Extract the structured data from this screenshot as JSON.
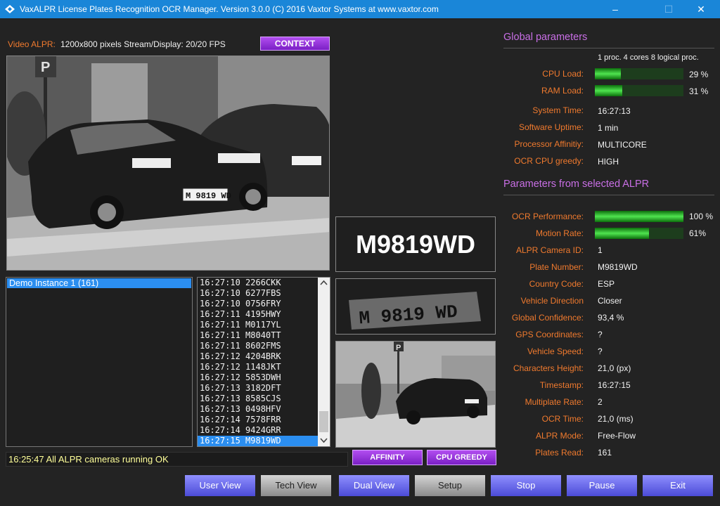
{
  "window": {
    "title": "VaxALPR License Plates Recognition OCR Manager. Version 3.0.0 (C) 2016 Vaxtor Systems at www.vaxtor.com",
    "minimize": "–",
    "maximize": "☐",
    "close": "✕"
  },
  "video": {
    "label": "Video ALPR:",
    "info": "1200x800 pixels Stream/Display: 20/20 FPS",
    "context_button": "CONTEXT",
    "plate_in_image": "M 9819 WD"
  },
  "recognized_plate": "M9819WD",
  "plate_crop_text": "M 9819 WD",
  "instances": [
    {
      "label": "Demo Instance 1 (161)"
    }
  ],
  "plate_reads": [
    "16:27:10 2266CKK",
    "16:27:10 6277FBS",
    "16:27:10 0756FRY",
    "16:27:11 4195HWY",
    "16:27:11 M0117YL",
    "16:27:11 M8040TT",
    "16:27:11 8602FMS",
    "16:27:12 4204BRK",
    "16:27:12 1148JKT",
    "16:27:12 5853DWH",
    "16:27:13 3182DFT",
    "16:27:13 8585CJS",
    "16:27:13 0498HFV",
    "16:27:14 7578FRR",
    "16:27:14 9424GRR",
    "16:27:15 M9819WD"
  ],
  "status_message": "16:25:47 All ALPR cameras running OK",
  "mid_buttons": {
    "affinity": "AFFINITY",
    "cpu_greedy": "CPU GREEDY"
  },
  "bottom_buttons": {
    "user_view": "User View",
    "tech_view": "Tech View",
    "dual_view": "Dual View",
    "setup": "Setup",
    "stop": "Stop",
    "pause": "Pause",
    "exit": "Exit"
  },
  "global": {
    "heading": "Global parameters",
    "cpu_info": "1 proc. 4 cores 8 logical proc.",
    "cpu_load_label": "CPU Load:",
    "cpu_load_value": "29 %",
    "cpu_load_fraction": 0.29,
    "ram_load_label": "RAM Load:",
    "ram_load_value": "31 %",
    "ram_load_fraction": 0.31,
    "rows": [
      {
        "label": "System Time:",
        "value": "16:27:13"
      },
      {
        "label": "Software Uptime:",
        "value": "1 min"
      },
      {
        "label": "Processor Affinitiy:",
        "value": "MULTICORE"
      },
      {
        "label": "OCR CPU greedy:",
        "value": "HIGH"
      }
    ]
  },
  "selected": {
    "heading": "Parameters from selected ALPR",
    "ocr_perf_label": "OCR Performance:",
    "ocr_perf_value": "100 %",
    "ocr_perf_fraction": 1.0,
    "motion_label": "Motion Rate:",
    "motion_value": "61%",
    "motion_fraction": 0.61,
    "rows": [
      {
        "label": "ALPR Camera ID:",
        "value": "1"
      },
      {
        "label": "Plate Number:",
        "value": "M9819WD"
      },
      {
        "label": "Country Code:",
        "value": "ESP"
      },
      {
        "label": "Vehicle Direction",
        "value": "Closer"
      },
      {
        "label": "Global Confidence:",
        "value": "93,4 %"
      },
      {
        "label": "GPS Coordinates:",
        "value": "?"
      },
      {
        "label": "Vehicle Speed:",
        "value": "?"
      },
      {
        "label": "Characters Height:",
        "value": "21,0 (px)"
      },
      {
        "label": "Timestamp:",
        "value": "16:27:15"
      },
      {
        "label": "Multiplate Rate:",
        "value": "2"
      },
      {
        "label": "OCR Time:",
        "value": "21,0 (ms)"
      },
      {
        "label": "ALPR Mode:",
        "value": "Free-Flow"
      },
      {
        "label": "Plates Read:",
        "value": "161"
      }
    ]
  },
  "colors": {
    "titlebar": "#1a86d8",
    "background": "#232323",
    "accent_orange": "#f07a2e",
    "heading_purple": "#c96fe6",
    "selection_blue": "#2b8ef0",
    "status_yellow": "#ffff99",
    "bar_green": "#4fe44f"
  }
}
